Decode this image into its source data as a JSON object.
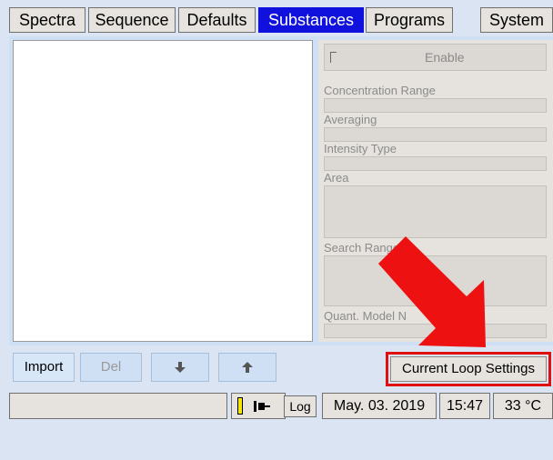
{
  "tabs": [
    {
      "label": "Spectra",
      "active": false
    },
    {
      "label": "Sequence",
      "active": false
    },
    {
      "label": "Defaults",
      "active": false
    },
    {
      "label": "Substances",
      "active": true
    },
    {
      "label": "Programs",
      "active": false
    },
    {
      "label": "System",
      "active": false
    }
  ],
  "panel": {
    "enable_label": "Enable",
    "concentration_range": "Concentration Range",
    "averaging": "Averaging",
    "intensity_type": "Intensity Type",
    "area": "Area",
    "search_range": "Search Range",
    "quant_model": "Quant. Model N"
  },
  "buttons": {
    "import": "Import",
    "del": "Del",
    "down_icon": "arrow-down-icon",
    "up_icon": "arrow-up-icon",
    "current_loop": "Current Loop Settings"
  },
  "status": {
    "log": "Log",
    "date": "May. 03. 2019",
    "time": "15:47",
    "temp": "33 °C"
  },
  "colors": {
    "active_tab": "#1111dd",
    "highlight_box": "#e01010",
    "arrow": "#ee1111",
    "indicator_yellow": "#f5e800"
  }
}
